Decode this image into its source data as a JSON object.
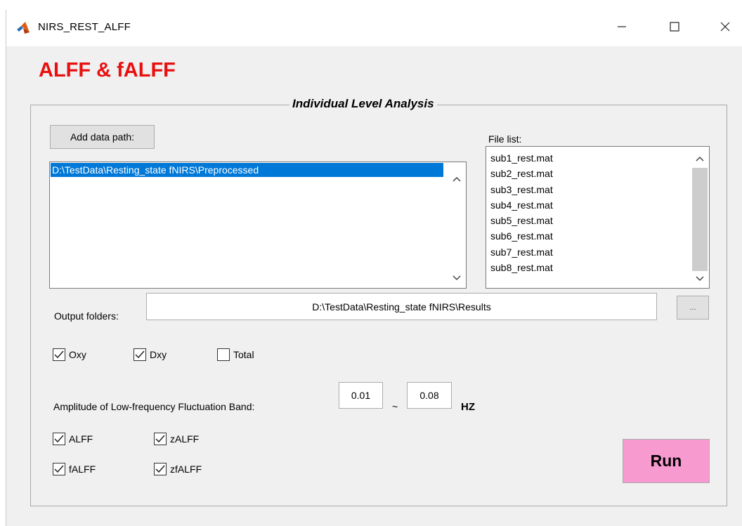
{
  "window": {
    "title": "NIRS_REST_ALFF"
  },
  "heading": "ALFF & fALFF",
  "panel": {
    "title": "Individual Level Analysis"
  },
  "data_path": {
    "button_label": "Add data path:",
    "items": [
      "D:\\TestData\\Resting_state fNIRS\\Preprocessed"
    ]
  },
  "file_list": {
    "label": "File list:",
    "items": [
      "sub1_rest.mat",
      "sub2_rest.mat",
      "sub3_rest.mat",
      "sub4_rest.mat",
      "sub5_rest.mat",
      "sub6_rest.mat",
      "sub7_rest.mat",
      "sub8_rest.mat"
    ]
  },
  "output": {
    "label": "Output folders:",
    "value": "D:\\TestData\\Resting_state fNIRS\\Results",
    "browse_label": "..."
  },
  "signals": {
    "oxy": {
      "label": "Oxy",
      "checked": true
    },
    "dxy": {
      "label": "Dxy",
      "checked": true
    },
    "total": {
      "label": "Total",
      "checked": false
    }
  },
  "band": {
    "label": "Amplitude of Low-frequency Fluctuation Band:",
    "low": "0.01",
    "separator": "~",
    "high": "0.08",
    "unit": "HZ"
  },
  "measures": {
    "alff": {
      "label": "ALFF",
      "checked": true
    },
    "zalff": {
      "label": "zALFF",
      "checked": true
    },
    "falff": {
      "label": "fALFF",
      "checked": true
    },
    "zfalff": {
      "label": "zfALFF",
      "checked": true
    }
  },
  "run_label": "Run",
  "colors": {
    "heading": "#e81010",
    "selection": "#0078d7",
    "run_button": "#f79ad0",
    "window_bg": "#f0f0f0"
  },
  "icons": {
    "app": "matlab-logo-icon",
    "minimize": "minimize-icon",
    "maximize": "maximize-icon",
    "close": "close-icon",
    "check": "checkmark-icon",
    "scroll_up": "chevron-up-icon",
    "scroll_down": "chevron-down-icon"
  }
}
